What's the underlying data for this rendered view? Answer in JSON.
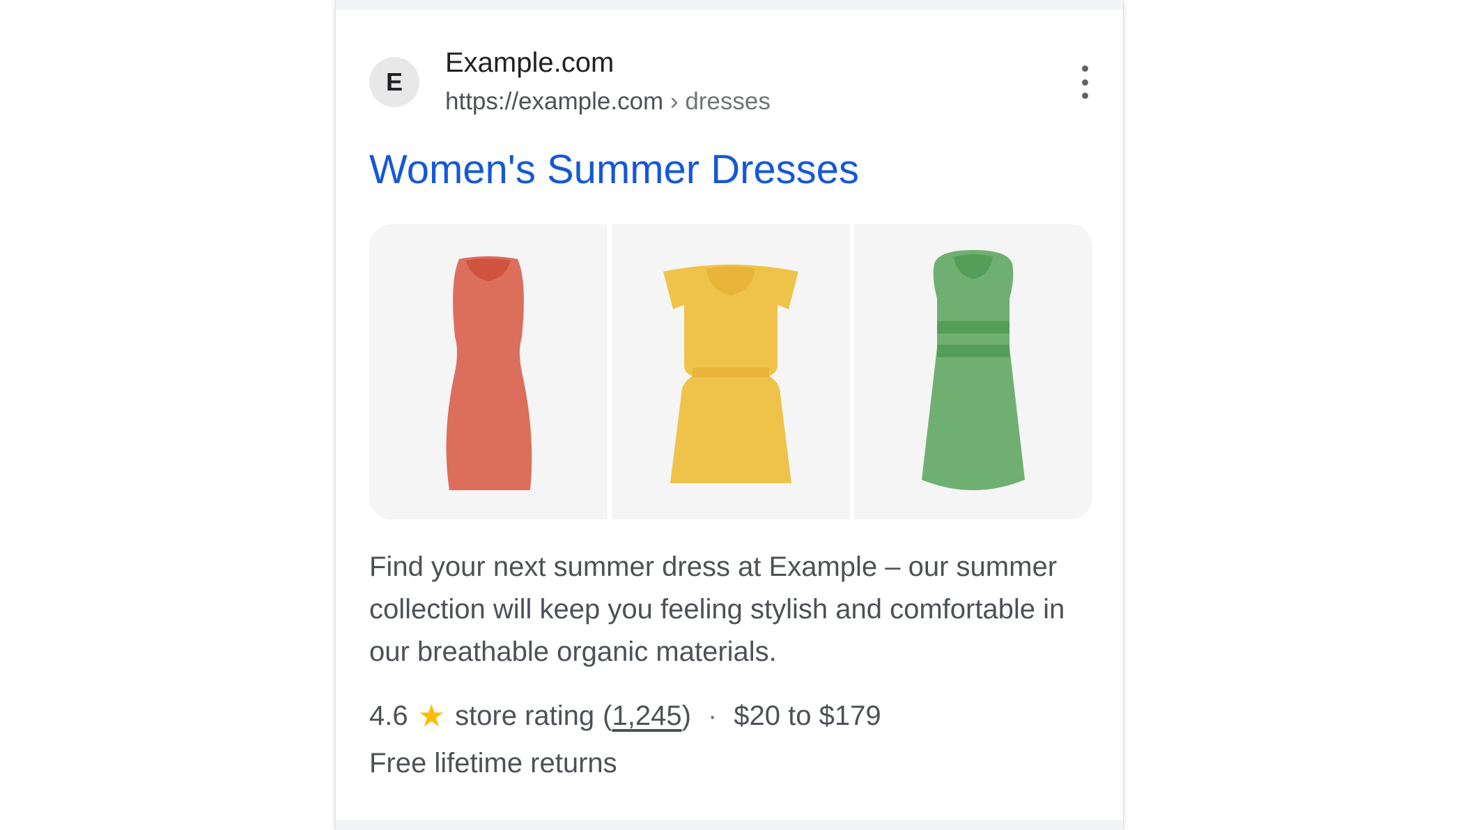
{
  "result": {
    "favicon_letter": "E",
    "site_name": "Example.com",
    "url_base": "https://example.com",
    "url_separator": " › ",
    "url_path": "dresses",
    "title": "Women's Summer Dresses",
    "images": [
      {
        "name": "red-dress",
        "color": "#db6f5c",
        "accent": "#d0533f"
      },
      {
        "name": "yellow-dress",
        "color": "#efc34a",
        "accent": "#e8b43a"
      },
      {
        "name": "green-dress",
        "color": "#6fb072",
        "accent": "#559e59"
      }
    ],
    "snippet": "Find your next summer dress at Example – our summer collection will keep you feeling stylish and comfortable in our breathable organic materials.",
    "rating_value": "4.6",
    "star_icon": "star-icon",
    "rating_label": "store rating",
    "rating_open_paren": "(",
    "rating_count": "1,245",
    "rating_close_paren": ")",
    "separator": "·",
    "price_range": "$20 to $179",
    "returns": "Free lifetime returns",
    "menu_icon": "more-vert-icon"
  },
  "colors": {
    "title_link": "#1558d6",
    "body_text": "#4d5156",
    "star": "#fbbc04"
  }
}
